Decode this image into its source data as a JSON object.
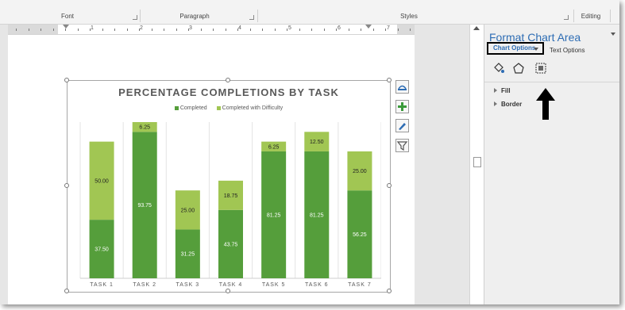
{
  "ribbon": {
    "groups": [
      {
        "label": "Font"
      },
      {
        "label": "Paragraph"
      },
      {
        "label": "Styles"
      },
      {
        "label": "Editing"
      }
    ]
  },
  "ruler": {
    "numbers": [
      "1",
      "2",
      "3",
      "4",
      "5",
      "6",
      "7"
    ]
  },
  "pane": {
    "title": "Format Chart Area",
    "tab_chart_options": "Chart Options",
    "tab_text_options": "Text Options",
    "section_fill": "Fill",
    "section_border": "Border",
    "icons": [
      "fill-line-icon",
      "effects-icon",
      "size-properties-icon"
    ]
  },
  "side_buttons": [
    "chart-elements-icon",
    "chart-styles-icon",
    "chart-filters-icon"
  ],
  "chart_data": {
    "type": "bar",
    "stacked": true,
    "title": "PERCENTAGE COMPLETIONS BY TASK",
    "categories": [
      "TASK 1",
      "TASK 2",
      "TASK 3",
      "TASK 4",
      "TASK 5",
      "TASK 6",
      "TASK 7"
    ],
    "series": [
      {
        "name": "Completed",
        "color": "#559e3b",
        "values": [
          37.5,
          93.75,
          31.25,
          43.75,
          81.25,
          81.25,
          56.25
        ],
        "labels": [
          "37.50",
          "93.75",
          "31.25",
          "43.75",
          "81.25",
          "81.25",
          "56.25"
        ]
      },
      {
        "name": "Completed with Difficulty",
        "color": "#a1c653",
        "values": [
          50.0,
          6.25,
          25.0,
          18.75,
          6.25,
          12.5,
          25.0
        ],
        "labels": [
          "50.00",
          "6.25",
          "25.00",
          "18.75",
          "6.25",
          "12.50",
          "25.00"
        ]
      }
    ],
    "ylim": [
      0,
      100
    ],
    "grid": "vertical",
    "legend": "top"
  }
}
